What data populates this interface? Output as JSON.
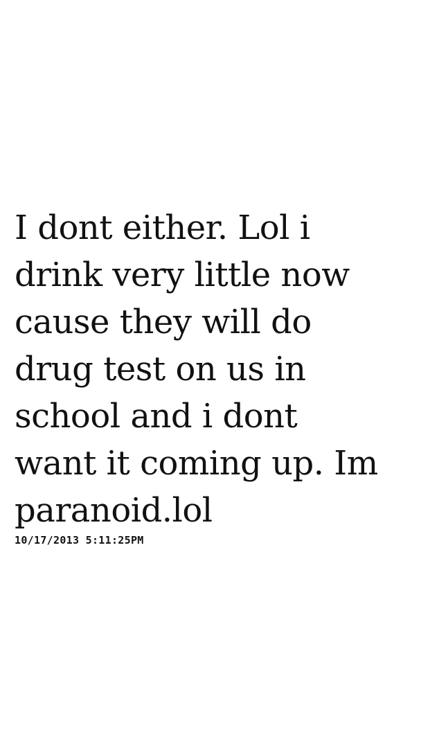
{
  "message": {
    "lines": [
      "I dont either. Lol i",
      "drink very little now",
      "cause they will do",
      "drug test on us in",
      "school and i dont",
      "want it coming up. Im",
      "paranoid.lol"
    ]
  },
  "timestamp": "10/17/2013 5:11:25PM",
  "colors": {
    "background": "#ffffff",
    "text": "#111111"
  }
}
